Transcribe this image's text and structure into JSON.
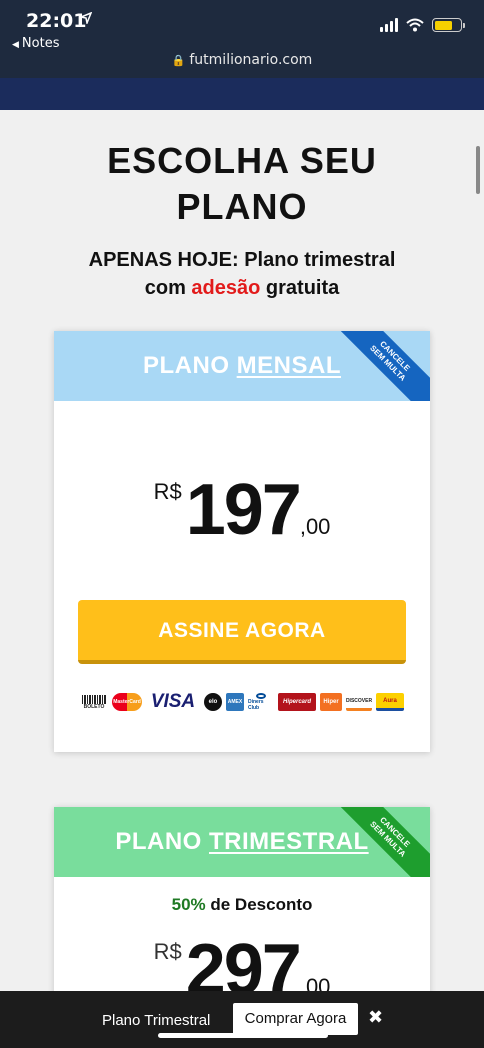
{
  "statusbar": {
    "time": "22:01",
    "back_label": "Notes",
    "url": "futmilionario.com",
    "battery_color": "#f5d000",
    "nav_color": "#1b2c5c"
  },
  "page": {
    "title_line1": "ESCOLHA SEU",
    "title_line2": "PLANO",
    "subtitle_part1": "APENAS HOJE: Plano trimestral",
    "subtitle_part2": "com ",
    "subtitle_highlight": "adesão",
    "subtitle_part3": " gratuita",
    "highlight_color": "#e21b1b"
  },
  "plans": [
    {
      "title_prefix": "PLANO ",
      "title_underlined": "MENSAL",
      "ribbon_line1": "CANCELE",
      "ribbon_line2": "SEM MULTA",
      "currency": "R$",
      "price_int": "197",
      "price_cents": ",00",
      "cta_label": "ASSINE AGORA",
      "header_color": "#a9d8f5",
      "cta_color": "#ffbf1a",
      "payment_methods": [
        "BOLETO",
        "MasterCard",
        "VISA",
        "elo",
        "AMEX",
        "Diners Club",
        "Hipercard",
        "Hiper",
        "DISCOVER",
        "Aura"
      ]
    },
    {
      "title_prefix": "PLANO ",
      "title_underlined": "TRIMESTRAL",
      "ribbon_line1": "CANCELE",
      "ribbon_line2": "SEM MULTA",
      "discount_value": "50%",
      "discount_label": " de Desconto",
      "currency": "R$",
      "price_int": "297",
      "price_cents": ",00",
      "header_color": "#79dd9c"
    }
  ],
  "sticky_bar": {
    "label": "Plano Trimestral",
    "button_label": "Comprar Agora",
    "close_glyph": "✖"
  }
}
